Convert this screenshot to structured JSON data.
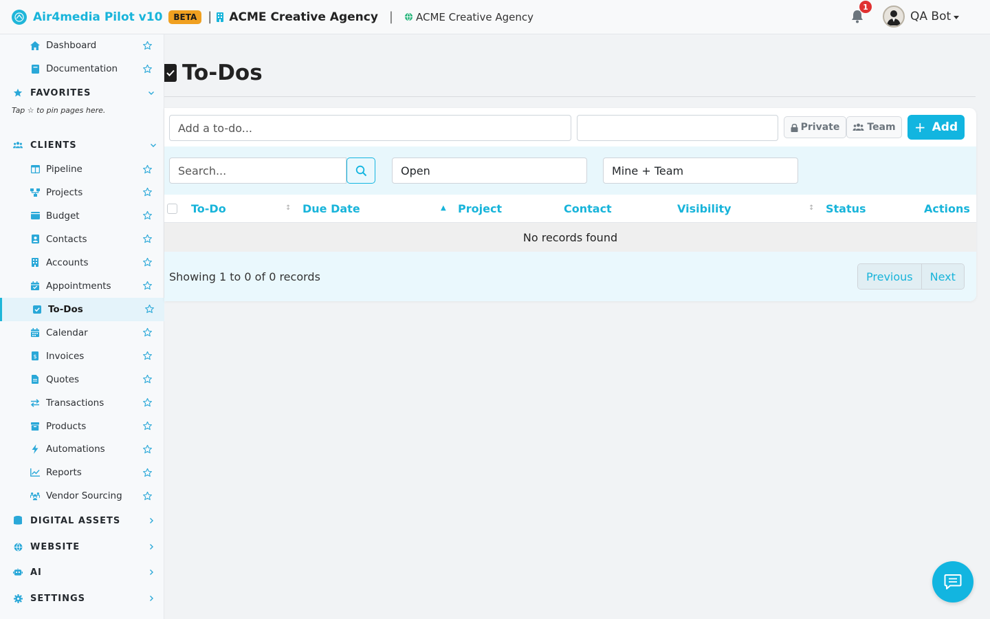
{
  "header": {
    "app_name": "Air4media Pilot v10",
    "badge": "BETA",
    "organization": "ACME Creative Agency",
    "workspace": "ACME Creative Agency",
    "notification_count": "1",
    "user_name": "QA Bot"
  },
  "sidebar": {
    "top_items": [
      {
        "label": "Dashboard",
        "icon": "home-icon"
      },
      {
        "label": "Documentation",
        "icon": "book-icon"
      }
    ],
    "favorites": {
      "label": "FAVORITES",
      "hint": "Tap ☆ to pin pages here."
    },
    "clients": {
      "label": "CLIENTS",
      "items": [
        {
          "label": "Pipeline",
          "icon": "columns-icon"
        },
        {
          "label": "Projects",
          "icon": "sitemap-icon"
        },
        {
          "label": "Budget",
          "icon": "wallet-icon"
        },
        {
          "label": "Contacts",
          "icon": "contact-card-icon"
        },
        {
          "label": "Accounts",
          "icon": "building-icon"
        },
        {
          "label": "Appointments",
          "icon": "calendar-check-icon"
        },
        {
          "label": "To-Dos",
          "icon": "checkbox-icon",
          "active": true
        },
        {
          "label": "Calendar",
          "icon": "calendar-icon"
        },
        {
          "label": "Invoices",
          "icon": "invoice-icon"
        },
        {
          "label": "Quotes",
          "icon": "file-icon"
        },
        {
          "label": "Transactions",
          "icon": "exchange-icon"
        },
        {
          "label": "Products",
          "icon": "box-icon"
        },
        {
          "label": "Automations",
          "icon": "bolt-icon"
        },
        {
          "label": "Reports",
          "icon": "chart-line-icon"
        },
        {
          "label": "Vendor Sourcing",
          "icon": "people-icon"
        }
      ]
    },
    "sections": [
      {
        "label": "DIGITAL ASSETS",
        "icon": "database-icon"
      },
      {
        "label": "WEBSITE",
        "icon": "globe-icon"
      },
      {
        "label": "AI",
        "icon": "robot-icon"
      },
      {
        "label": "SETTINGS",
        "icon": "gear-icon"
      }
    ]
  },
  "page": {
    "title": "To-Dos",
    "add_placeholder": "Add a to-do...",
    "due_date_value": "",
    "visibility_private": "Private",
    "visibility_team": "Team",
    "add_button": "Add",
    "search_placeholder": "Search...",
    "status_filter": "Open",
    "owner_filter": "Mine + Team",
    "columns": [
      "To-Do",
      "Due Date",
      "Project",
      "Contact",
      "Visibility",
      "Status",
      "Actions"
    ],
    "empty_message": "No records found",
    "showing": "Showing 1 to 0 of 0 records",
    "previous": "Previous",
    "next": "Next"
  },
  "colors": {
    "accent": "#12b5e0",
    "beta": "#f0a020",
    "notification": "#e03131"
  }
}
